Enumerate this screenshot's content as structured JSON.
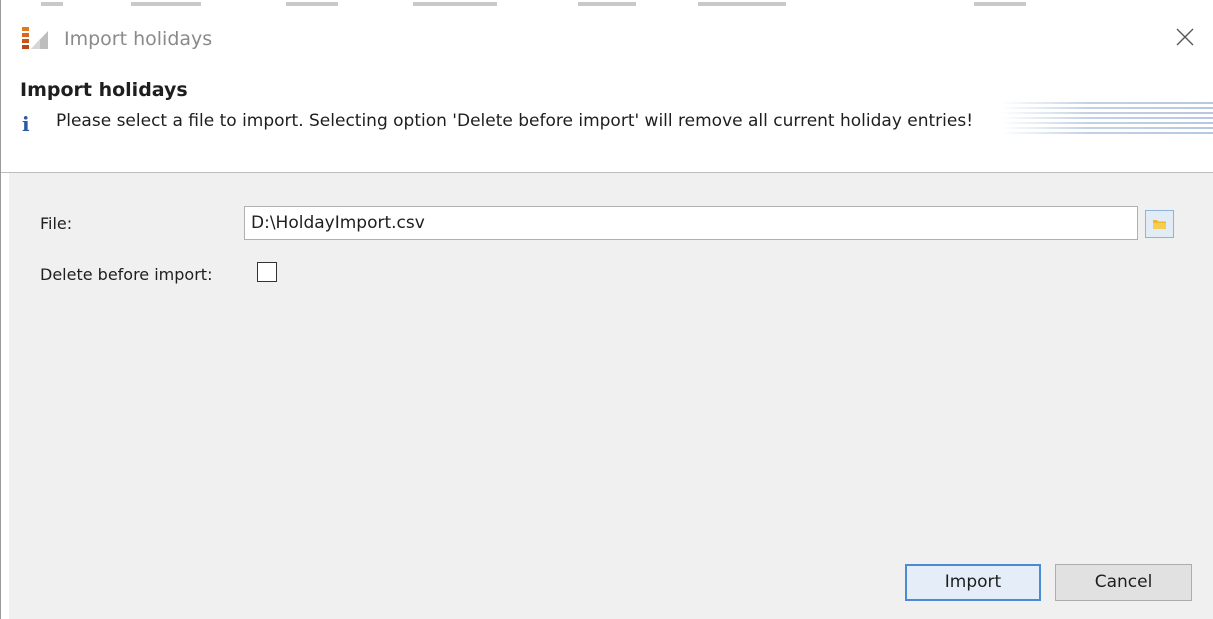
{
  "window": {
    "title": "Import holidays"
  },
  "header": {
    "title": "Import holidays",
    "info_text": "Please select a file to import. Selecting option 'Delete before import' will remove all current holiday entries!",
    "info_icon": "info-icon"
  },
  "form": {
    "file_label": "File:",
    "file_value": "D:\\HoldayImport.csv",
    "delete_label": "Delete before import:",
    "delete_checked": false,
    "browse_icon": "folder-icon"
  },
  "buttons": {
    "import_label": "Import",
    "cancel_label": "Cancel"
  },
  "colors": {
    "accent": "#4a8bd4",
    "content_bg": "#f0f0f0",
    "info_icon": "#2a5aa0"
  }
}
